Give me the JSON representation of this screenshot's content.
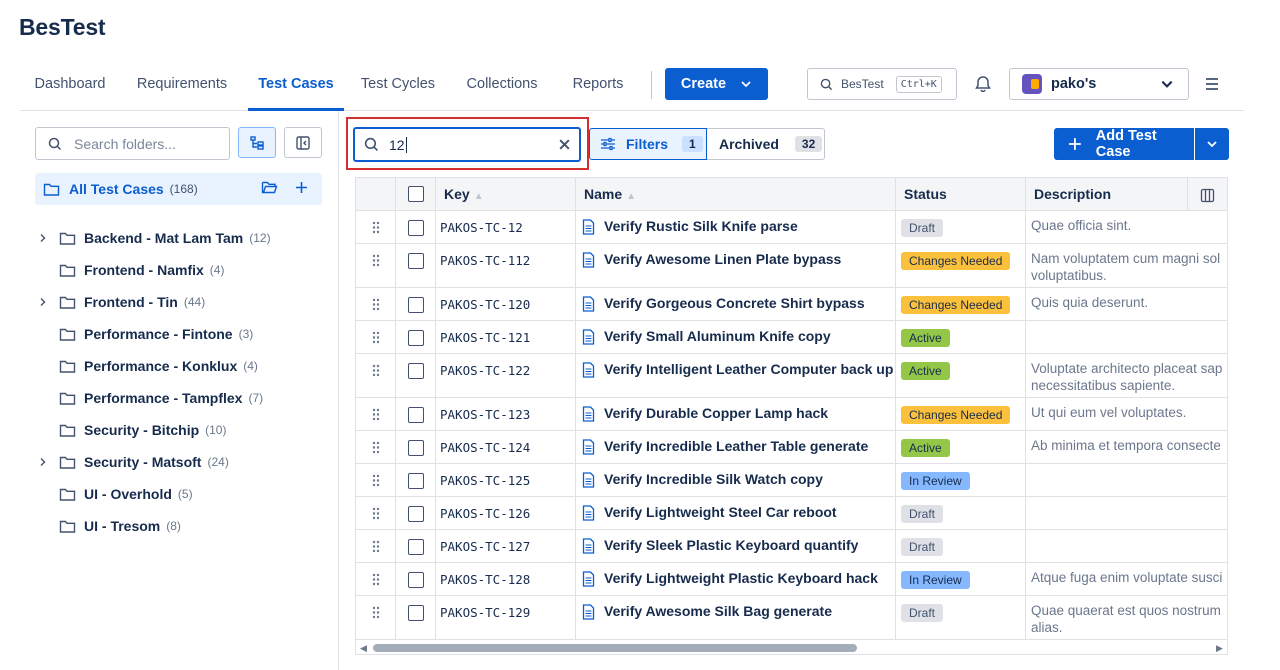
{
  "app": {
    "title": "BesTest"
  },
  "nav": {
    "tabs": [
      "Dashboard",
      "Requirements",
      "Test Cases",
      "Test Cycles",
      "Collections",
      "Reports"
    ],
    "active": "Test Cases",
    "create_label": "Create",
    "search_label": "BesTest",
    "search_shortcut": "Ctrl+K",
    "workspace_name": "pako's"
  },
  "sidebar": {
    "search_placeholder": "Search folders...",
    "all": {
      "label": "All Test Cases",
      "count": "(168)"
    },
    "folders": [
      {
        "label": "Backend - Mat Lam Tam",
        "count": "(12)",
        "expandable": true
      },
      {
        "label": "Frontend - Namfix",
        "count": "(4)",
        "expandable": false
      },
      {
        "label": "Frontend - Tin",
        "count": "(44)",
        "expandable": true
      },
      {
        "label": "Performance - Fintone",
        "count": "(3)",
        "expandable": false
      },
      {
        "label": "Performance - Konklux",
        "count": "(4)",
        "expandable": false
      },
      {
        "label": "Performance - Tampflex",
        "count": "(7)",
        "expandable": false
      },
      {
        "label": "Security - Bitchip",
        "count": "(10)",
        "expandable": false
      },
      {
        "label": "Security - Matsoft",
        "count": "(24)",
        "expandable": true
      },
      {
        "label": "UI - Overhold",
        "count": "(5)",
        "expandable": false
      },
      {
        "label": "UI - Tresom",
        "count": "(8)",
        "expandable": false
      }
    ]
  },
  "toolbar": {
    "search_value": "12",
    "filters_label": "Filters",
    "filters_count": "1",
    "archived_label": "Archived",
    "archived_count": "32",
    "add_label": "Add Test Case"
  },
  "table": {
    "columns": {
      "key": "Key",
      "name": "Name",
      "status": "Status",
      "description": "Description"
    },
    "rows": [
      {
        "key": "PAKOS-TC-12",
        "name": "Verify Rustic Silk Knife parse",
        "status": "Draft",
        "status_kind": "draft",
        "description": "Quae officia sint."
      },
      {
        "key": "PAKOS-TC-112",
        "name": "Verify Awesome Linen Plate bypass",
        "status": "Changes Needed",
        "status_kind": "changes",
        "description": "Nam voluptatem cum magni sol voluptatibus."
      },
      {
        "key": "PAKOS-TC-120",
        "name": "Verify Gorgeous Concrete Shirt bypass",
        "status": "Changes Needed",
        "status_kind": "changes",
        "description": "Quis quia deserunt."
      },
      {
        "key": "PAKOS-TC-121",
        "name": "Verify Small Aluminum Knife copy",
        "status": "Active",
        "status_kind": "active",
        "description": ""
      },
      {
        "key": "PAKOS-TC-122",
        "name": "Verify Intelligent Leather Computer back up",
        "status": "Active",
        "status_kind": "active",
        "description": "Voluptate architecto placeat sap necessitatibus sapiente."
      },
      {
        "key": "PAKOS-TC-123",
        "name": "Verify Durable Copper Lamp hack",
        "status": "Changes Needed",
        "status_kind": "changes",
        "description": "Ut qui eum vel voluptates."
      },
      {
        "key": "PAKOS-TC-124",
        "name": "Verify Incredible Leather Table generate",
        "status": "Active",
        "status_kind": "active",
        "description": "Ab minima et tempora consecte"
      },
      {
        "key": "PAKOS-TC-125",
        "name": "Verify Incredible Silk Watch copy",
        "status": "In Review",
        "status_kind": "review",
        "description": ""
      },
      {
        "key": "PAKOS-TC-126",
        "name": "Verify Lightweight Steel Car reboot",
        "status": "Draft",
        "status_kind": "draft",
        "description": ""
      },
      {
        "key": "PAKOS-TC-127",
        "name": "Verify Sleek Plastic Keyboard quantify",
        "status": "Draft",
        "status_kind": "draft",
        "description": ""
      },
      {
        "key": "PAKOS-TC-128",
        "name": "Verify Lightweight Plastic Keyboard hack",
        "status": "In Review",
        "status_kind": "review",
        "description": "Atque fuga enim voluptate susci"
      },
      {
        "key": "PAKOS-TC-129",
        "name": "Verify Awesome Silk Bag generate",
        "status": "Draft",
        "status_kind": "draft",
        "description": "Quae quaerat est quos nostrum alias."
      }
    ]
  },
  "colors": {
    "primary": "#0b5ecf",
    "highlight": "#d32f2f"
  }
}
